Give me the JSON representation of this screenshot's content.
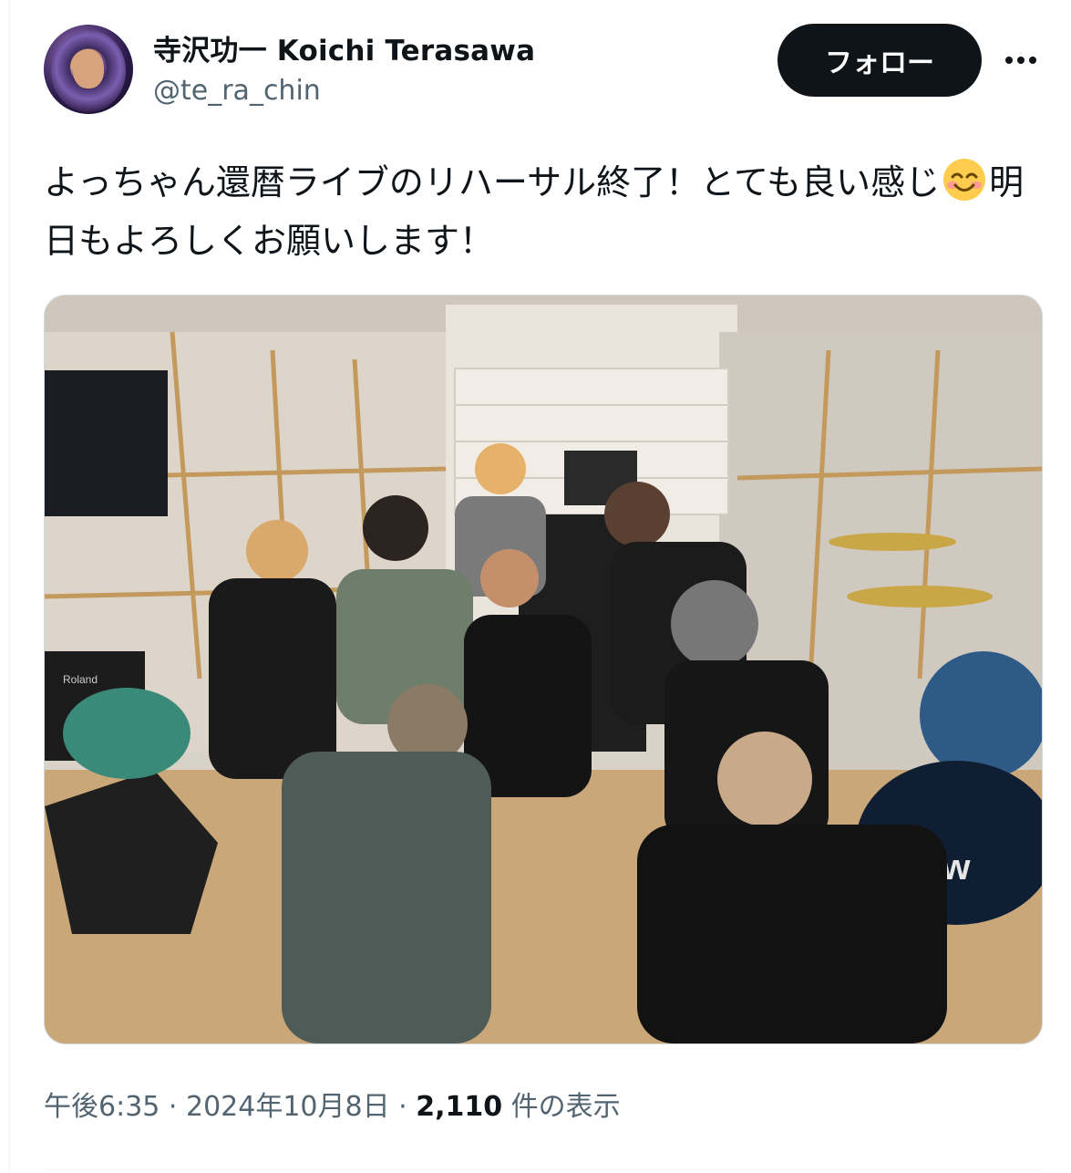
{
  "user": {
    "display_name": "寺沢功一 Koichi Terasawa",
    "handle": "@te_ra_chin",
    "avatar_icon": "profile-photo"
  },
  "follow_label": "フォロー",
  "more_icon": "more-horizontal-icon",
  "tweet": {
    "text_before_emoji": "よっちゃん還暦ライブのリハーサル終了！とても良い感じ",
    "emoji": "smiling-face-with-smiling-eyes-emoji",
    "text_after_emoji": "明日もよろしくお願いします！"
  },
  "photo": {
    "description_icon": "band-group-photo",
    "logos": {
      "amp_brand": "Roland",
      "drum_brand": "dw"
    }
  },
  "meta": {
    "time": "午後6:35",
    "separator": " · ",
    "date": "2024年10月8日",
    "views_count": "2,110",
    "views_label": " 件の表示"
  },
  "colors": {
    "text": "#0f1419",
    "secondary": "#536471",
    "button_bg": "#0f1419",
    "border": "#cfd9de"
  }
}
